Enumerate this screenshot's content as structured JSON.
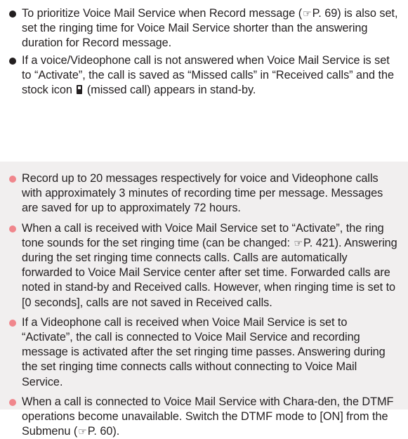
{
  "colors": {
    "bullet_top": "#231f20",
    "bullet_note": "#f0868c",
    "note_background": "#f1efef"
  },
  "top_bullets": [
    {
      "parts": [
        "To prioritize Voice Mail Service when Record message (",
        "P. 69) is also set, set the ringing time for Voice Mail Service shorter than the answering duration for Record message."
      ]
    },
    {
      "parts": [
        "If a voice/Videophone call is not answered when Voice Mail Service is set to “Activate”, the call is saved as “Missed calls” in “Received calls” and the stock icon ",
        " (missed call) appears in stand-by."
      ]
    }
  ],
  "note_bullets": [
    {
      "parts": [
        "Record up to 20 messages respectively for voice and Videophone calls with approximately 3 minutes of recording time per message. Messages are saved for up to approximately 72 hours."
      ]
    },
    {
      "parts": [
        "When a call is received with Voice Mail Service set to “Activate”, the ring tone sounds for the set ringing time (can be changed: ",
        "P. 421). Answering during the set ringing time connects calls. Calls are automatically forwarded to Voice Mail Service center after set time. Forwarded calls are noted in stand-by and Received calls. However, when ringing time is set to [0 seconds], calls are not saved in Received calls."
      ]
    },
    {
      "parts": [
        "If a Videophone call is received when Voice Mail Service is set to “Activate”, the call is connected to Voice Mail Service and recording message is activated after the set ringing time passes. Answering during the set ringing time connects calls without connecting to Voice Mail Service."
      ]
    },
    {
      "parts": [
        "When a call is connected to Voice Mail Service with Chara-den, the DTMF operations become unavailable. Switch the DTMF mode to [ON] from the Submenu (",
        "P. 60)."
      ]
    }
  ]
}
